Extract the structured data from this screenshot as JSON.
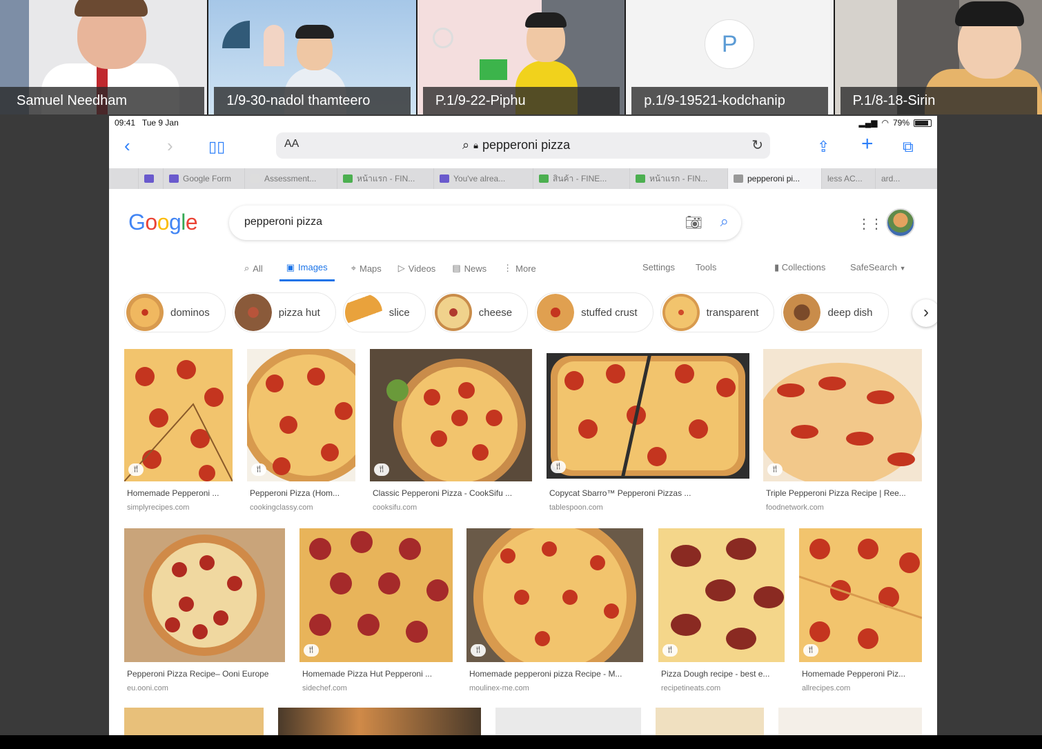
{
  "participants": [
    {
      "name": "Samuel Needham"
    },
    {
      "name": "1/9-30-nadol thamteero"
    },
    {
      "name": "P.1/9-22-Piphu"
    },
    {
      "name": "p.1/9-19521-kodchanip",
      "avatar_letter": "P"
    },
    {
      "name": "P.1/8-18-Sirin"
    }
  ],
  "status_bar": {
    "time": "09:41",
    "date": "Tue 9 Jan",
    "battery": "79%"
  },
  "address_bar": {
    "text_size_label": "AA",
    "query": "pepperoni pizza"
  },
  "tabs": [
    {
      "label": "",
      "color": "#333333"
    },
    {
      "label": "",
      "color": "#6a5acd"
    },
    {
      "label": "Google Form",
      "color": "#6a5acd"
    },
    {
      "label": "Assessment...",
      "color": "#cccccc"
    },
    {
      "label": "หน้าแรก - FIN...",
      "color": "#4caf50"
    },
    {
      "label": "You've alrea...",
      "color": "#6a5acd"
    },
    {
      "label": "สินค้า - FINE...",
      "color": "#4caf50"
    },
    {
      "label": "หน้าแรก - FIN...",
      "color": "#4caf50"
    },
    {
      "label": "pepperoni pi...",
      "color": "#999999",
      "active": true
    },
    {
      "label": "less AC...",
      "color": "#cccccc"
    },
    {
      "label": "ard...",
      "color": "#cccccc"
    }
  ],
  "google": {
    "logo": "Google",
    "search_query": "pepperoni pizza",
    "nav": {
      "all": "All",
      "images": "Images",
      "maps": "Maps",
      "videos": "Videos",
      "news": "News",
      "more": "More",
      "settings": "Settings",
      "tools": "Tools",
      "collections": "Collections",
      "safesearch": "SafeSearch"
    },
    "chips": [
      "dominos",
      "pizza hut",
      "slice",
      "cheese",
      "stuffed crust",
      "transparent",
      "deep dish"
    ],
    "row1": [
      {
        "caption": "Homemade Pepperoni ...",
        "source": "simplyrecipes.com"
      },
      {
        "caption": "Pepperoni Pizza (Hom...",
        "source": "cookingclassy.com"
      },
      {
        "caption": "Classic Pepperoni Pizza - CookSifu ...",
        "source": "cooksifu.com"
      },
      {
        "caption": "Copycat Sbarro™ Pepperoni Pizzas ...",
        "source": "tablespoon.com"
      },
      {
        "caption": "Triple Pepperoni Pizza Recipe | Ree...",
        "source": "foodnetwork.com"
      }
    ],
    "row2": [
      {
        "caption": "Pepperoni Pizza Recipe– Ooni Europe",
        "source": "eu.ooni.com"
      },
      {
        "caption": "Homemade Pizza Hut Pepperoni ...",
        "source": "sidechef.com"
      },
      {
        "caption": "Homemade pepperoni pizza Recipe - M...",
        "source": "moulinex-me.com"
      },
      {
        "caption": "Pizza Dough recipe - best e...",
        "source": "recipetineats.com"
      },
      {
        "caption": "Homemade Pepperoni Piz...",
        "source": "allrecipes.com"
      }
    ]
  },
  "colors": {
    "accent": "#1a73e8",
    "safari_blue": "#2d7ff9",
    "pepperoni": "#c4351f",
    "cheese": "#f2c46d",
    "crust": "#d89a4e"
  }
}
